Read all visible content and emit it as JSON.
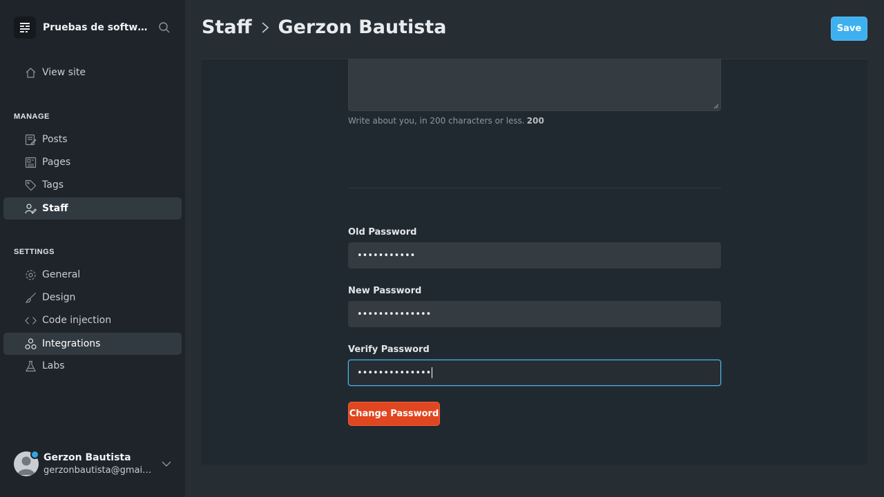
{
  "sidebar": {
    "site_name": "Pruebas de software",
    "view_site": "View site",
    "manage_title": "MANAGE",
    "settings_title": "SETTINGS",
    "manage_items": [
      {
        "label": "Posts",
        "icon": "posts-icon"
      },
      {
        "label": "Pages",
        "icon": "pages-icon"
      },
      {
        "label": "Tags",
        "icon": "tag-icon"
      },
      {
        "label": "Staff",
        "icon": "staff-icon",
        "active": true
      }
    ],
    "settings_items": [
      {
        "label": "General",
        "icon": "gear-icon"
      },
      {
        "label": "Design",
        "icon": "brush-icon"
      },
      {
        "label": "Code injection",
        "icon": "code-icon"
      },
      {
        "label": "Integrations",
        "icon": "integrations-icon",
        "hover": true
      },
      {
        "label": "Labs",
        "icon": "flask-icon"
      }
    ],
    "user": {
      "name": "Gerzon Bautista",
      "email": "gerzonbautista@gmail.com"
    }
  },
  "header": {
    "breadcrumb_parent": "Staff",
    "breadcrumb_current": "Gerzon Bautista",
    "save_label": "Save"
  },
  "bio": {
    "hint": "Write about you, in 200 characters or less.",
    "count": "200"
  },
  "password": {
    "old_label": "Old Password",
    "old_value": "•••••••••••",
    "new_label": "New Password",
    "new_value": "••••••••••••••",
    "verify_label": "Verify Password",
    "verify_value": "••••••••••••••",
    "change_label": "Change Password"
  },
  "colors": {
    "accent_blue": "#3eb0ef",
    "danger_red": "#e0461f",
    "sidebar_bg": "#1e2429",
    "main_bg": "#262d33"
  }
}
